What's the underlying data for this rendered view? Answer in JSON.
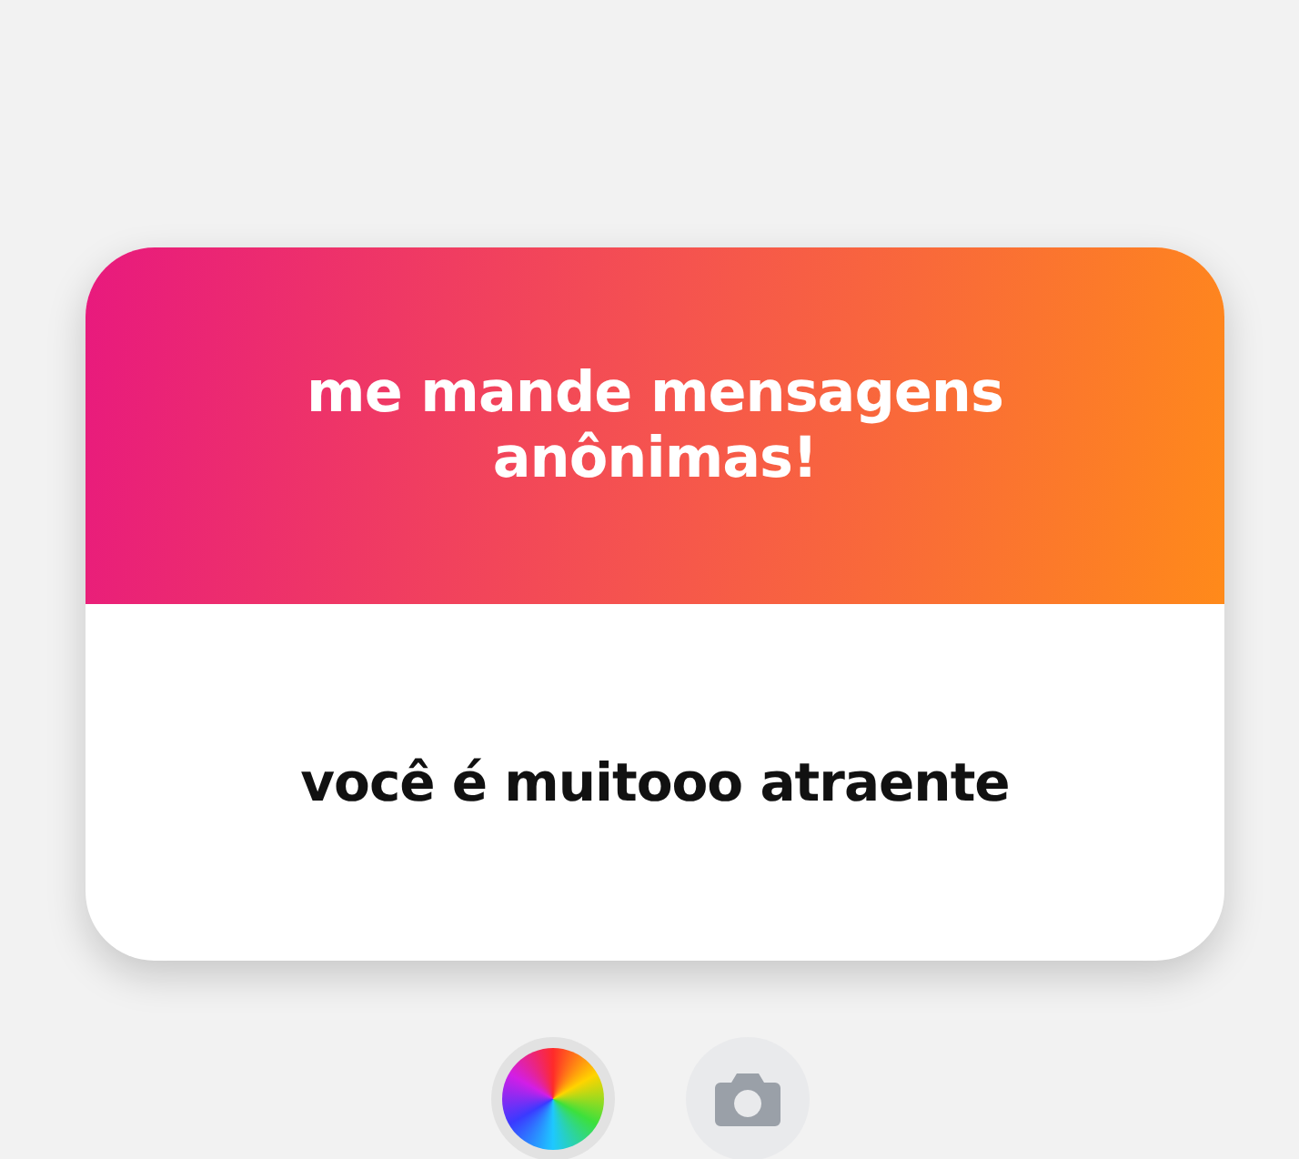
{
  "card": {
    "title": "me mande mensagens anônimas!",
    "message": "você é muitooo atraente"
  },
  "controls": [
    {
      "kind": "color-picker"
    },
    {
      "kind": "camera"
    }
  ]
}
